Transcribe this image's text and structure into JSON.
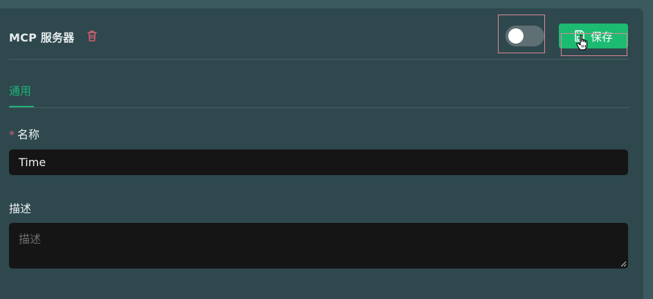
{
  "header": {
    "title": "MCP 服务器",
    "delete_icon": "trash-icon",
    "toggle": {
      "enabled": false
    },
    "save_label": "保存",
    "save_icon": "floppy-disk-icon"
  },
  "tabs": [
    {
      "label": "通用",
      "active": true
    }
  ],
  "form": {
    "name": {
      "label": "名称",
      "required_mark": "*",
      "value": "Time"
    },
    "description": {
      "label": "描述",
      "placeholder": "描述",
      "value": ""
    }
  },
  "colors": {
    "accent": "#1fb578",
    "save_button": "#1dba72",
    "danger": "#d8606d",
    "panel_bg": "#2e484e",
    "input_bg": "#151515"
  }
}
